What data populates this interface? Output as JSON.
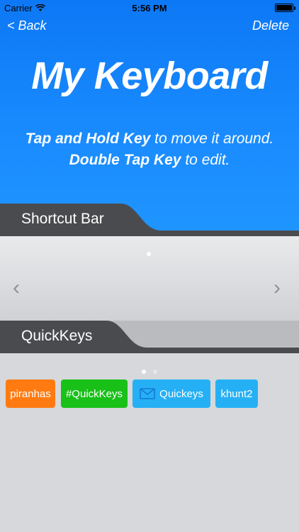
{
  "status": {
    "carrier": "Carrier",
    "time": "5:56 PM"
  },
  "nav": {
    "back_label": "< Back",
    "delete_label": "Delete"
  },
  "title": "My Keyboard",
  "hint1": {
    "bold": "Tap and Hold Key",
    "rest": " to move it around."
  },
  "hint2": {
    "bold": "Double Tap Key",
    "rest": " to edit."
  },
  "sections": {
    "shortcut_bar": "Shortcut Bar",
    "quickkeys": "QuickKeys"
  },
  "keys": [
    {
      "label": "piranhas",
      "color": "#ff7b12"
    },
    {
      "label": "#QuickKeys",
      "color": "#18c018"
    },
    {
      "label": "Quickeys",
      "color": "#25b0f5",
      "icon": "envelope-icon"
    },
    {
      "label": "khunt2",
      "color": "#25b0f5"
    }
  ],
  "colors": {
    "accent": "#1a8cff",
    "tab": "#4a4b4e"
  }
}
